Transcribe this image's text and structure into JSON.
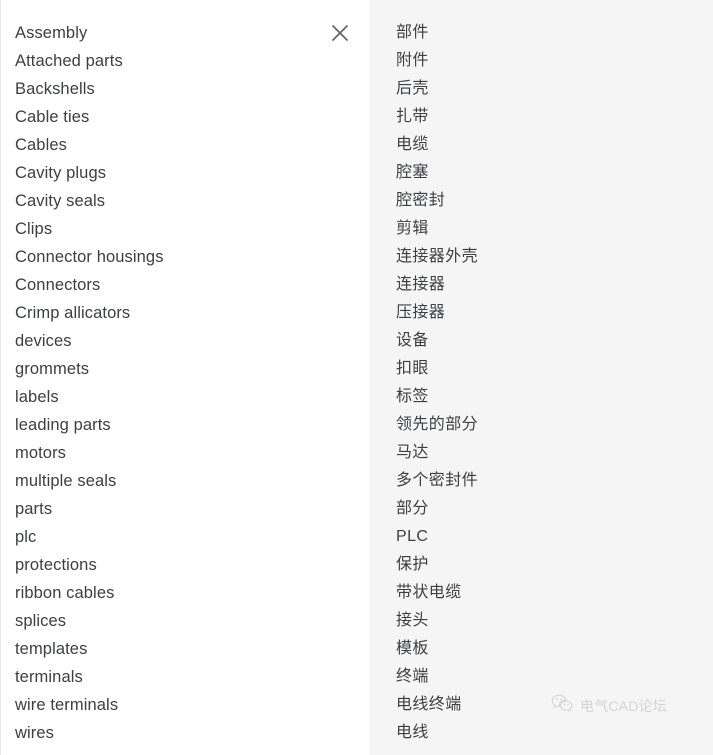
{
  "panels": {
    "source": {
      "items": [
        "Assembly",
        "Attached parts",
        "Backshells",
        "Cable ties",
        "Cables",
        "Cavity plugs",
        "Cavity seals",
        "Clips",
        "Connector housings",
        "Connectors",
        "Crimp allicators",
        "devices",
        "grommets",
        "labels",
        "leading parts",
        "motors",
        "multiple seals",
        "parts",
        "plc",
        "protections",
        "ribbon cables",
        "splices",
        "templates",
        "terminals",
        "wire terminals",
        "wires"
      ]
    },
    "translation": {
      "items": [
        "部件",
        "附件",
        "后壳",
        "扎带",
        "电缆",
        "腔塞",
        "腔密封",
        "剪辑",
        "连接器外壳",
        "连接器",
        "压接器",
        "设备",
        "扣眼",
        "标签",
        "领先的部分",
        "马达",
        "多个密封件",
        "部分",
        "PLC",
        "保护",
        "带状电缆",
        "接头",
        "模板",
        "终端",
        "电线终端",
        "电线"
      ]
    }
  },
  "close_button": {
    "icon": "close-icon",
    "label": "×"
  },
  "watermark": {
    "icon": "wechat-icon",
    "text": "电气CAD论坛"
  },
  "colors": {
    "source_background": "#ffffff",
    "translation_background": "#f5f5f5",
    "text": "#3c4043",
    "close_icon": "#5f6368",
    "watermark_text": "#9aa0a6"
  }
}
